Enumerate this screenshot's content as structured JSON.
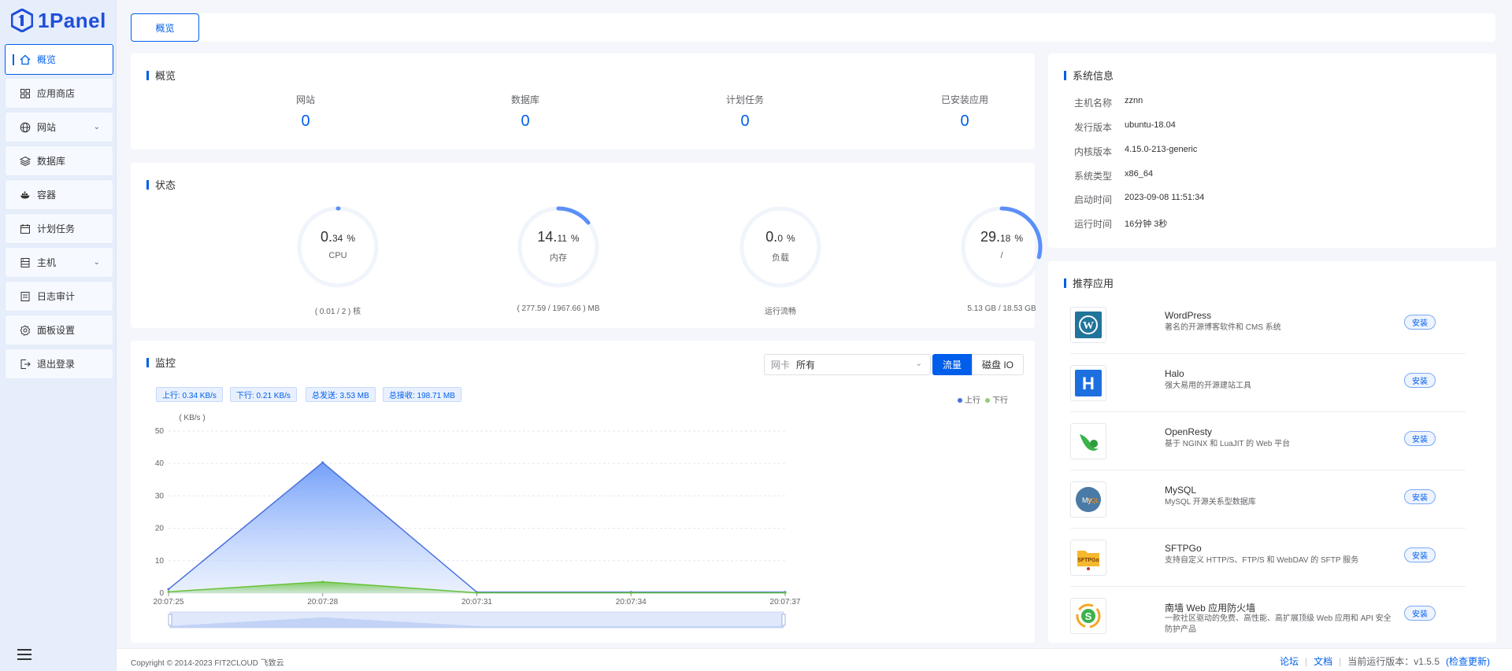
{
  "brand": {
    "name": "1Panel",
    "color": "#1f4fd8"
  },
  "accent": "#005eeb",
  "sidebar": {
    "items": [
      {
        "label": "概览",
        "icon": "home-icon",
        "active": true
      },
      {
        "label": "应用商店",
        "icon": "grid-icon"
      },
      {
        "label": "网站",
        "icon": "globe-icon",
        "has_submenu": true
      },
      {
        "label": "数据库",
        "icon": "layers-icon"
      },
      {
        "label": "容器",
        "icon": "docker-icon"
      },
      {
        "label": "计划任务",
        "icon": "calendar-icon"
      },
      {
        "label": "主机",
        "icon": "server-icon",
        "has_submenu": true
      },
      {
        "label": "日志审计",
        "icon": "log-icon"
      },
      {
        "label": "面板设置",
        "icon": "gear-icon"
      },
      {
        "label": "退出登录",
        "icon": "logout-icon"
      }
    ]
  },
  "tabs": [
    {
      "label": "概览"
    }
  ],
  "overview": {
    "title": "概览",
    "stats": [
      {
        "label": "网站",
        "value": "0"
      },
      {
        "label": "数据库",
        "value": "0"
      },
      {
        "label": "计划任务",
        "value": "0"
      },
      {
        "label": "已安装应用",
        "value": "0"
      }
    ]
  },
  "status": {
    "title": "状态",
    "gauges": [
      {
        "int": "0.",
        "dec": "34",
        "unit": "%",
        "label": "CPU",
        "sub": "( 0.01 / 2 ) 核",
        "percent": 0.34
      },
      {
        "int": "14.",
        "dec": "11",
        "unit": "%",
        "label": "内存",
        "sub": "( 277.59 / 1967.66 ) MB",
        "percent": 14.11
      },
      {
        "int": "0.",
        "dec": "0",
        "unit": "%",
        "label": "负载",
        "sub": "运行流畅",
        "percent": 0.0
      },
      {
        "int": "29.",
        "dec": "18",
        "unit": "%",
        "label": "/",
        "sub": "5.13 GB / 18.53 GB",
        "percent": 29.18
      }
    ]
  },
  "monitor": {
    "title": "监控",
    "nic_label": "网卡",
    "nic_value": "所有",
    "btn_traffic": "流量",
    "btn_diskio": "磁盘 IO",
    "badges": [
      "上行: 0.34 KB/s",
      "下行: 0.21 KB/s",
      "总发送: 3.53 MB",
      "总接收: 198.71 MB"
    ],
    "legend_up": "上行",
    "legend_down": "下行"
  },
  "chart_data": {
    "type": "area",
    "ylabel": "( KB/s )",
    "ylim": [
      0,
      50
    ],
    "yticks": [
      "0",
      "10",
      "20",
      "30",
      "40",
      "50"
    ],
    "x": [
      "20:07:25",
      "20:07:28",
      "20:07:31",
      "20:07:34",
      "20:07:37"
    ],
    "series": [
      {
        "name": "上行",
        "values": [
          1.2,
          40.3,
          0.3,
          0.3,
          0.3
        ],
        "color": "#4a6fdc"
      },
      {
        "name": "下行",
        "values": [
          0.4,
          3.5,
          0.1,
          0.1,
          0.1
        ],
        "color": "#67c23a"
      }
    ]
  },
  "sysinfo": {
    "title": "系统信息",
    "rows": [
      {
        "k": "主机名称",
        "v": "zznn"
      },
      {
        "k": "发行版本",
        "v": "ubuntu-18.04"
      },
      {
        "k": "内核版本",
        "v": "4.15.0-213-generic"
      },
      {
        "k": "系统类型",
        "v": "x86_64"
      },
      {
        "k": "启动时间",
        "v": "2023-09-08 11:51:34"
      },
      {
        "k": "运行时间",
        "v": "16分钟 3秒"
      }
    ]
  },
  "apps": {
    "title": "推荐应用",
    "install_label": "安装",
    "items": [
      {
        "name": "WordPress",
        "desc": "著名的开源博客软件和 CMS 系统",
        "icon": "wordpress-icon"
      },
      {
        "name": "Halo",
        "desc": "强大易用的开源建站工具",
        "icon": "halo-icon"
      },
      {
        "name": "OpenResty",
        "desc": "基于 NGINX 和 LuaJIT 的 Web 平台",
        "icon": "openresty-icon"
      },
      {
        "name": "MySQL",
        "desc": "MySQL 开源关系型数据库",
        "icon": "mysql-icon"
      },
      {
        "name": "SFTPGo",
        "desc": "支持自定义 HTTP/S、FTP/S 和 WebDAV 的 SFTP 服务",
        "icon": "sftpgo-icon"
      },
      {
        "name": "南墙 Web 应用防火墙",
        "desc": "一款社区驱动的免费、高性能、高扩展顶级 Web 应用和 API 安全防护产品",
        "icon": "uusec-icon"
      }
    ]
  },
  "footer": {
    "copyright": "Copyright © 2014-2023 FIT2CLOUD 飞致云",
    "forum": "论坛",
    "docs": "文档",
    "version_label": "当前运行版本：",
    "version": "v1.5.5",
    "check_update": "(检查更新)"
  }
}
